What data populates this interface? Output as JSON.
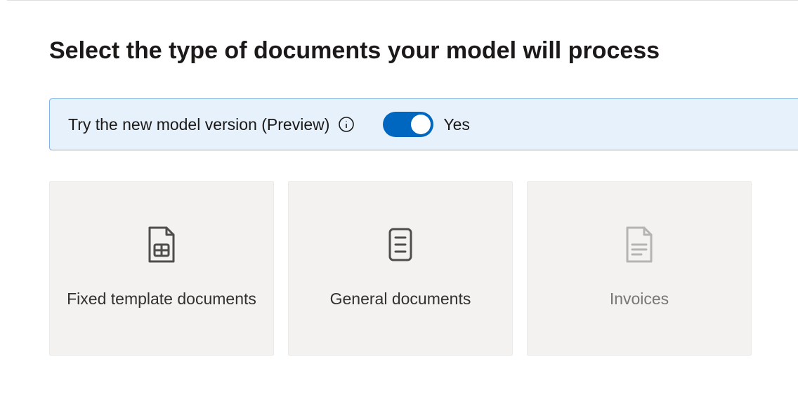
{
  "page": {
    "title": "Select the type of documents your model will process"
  },
  "preview": {
    "label": "Try the new model version (Preview)",
    "toggle_state": "Yes",
    "toggle_on": true
  },
  "cards": [
    {
      "id": "fixed-template",
      "label": "Fixed template documents",
      "enabled": true
    },
    {
      "id": "general-documents",
      "label": "General documents",
      "enabled": true
    },
    {
      "id": "invoices",
      "label": "Invoices",
      "enabled": false
    }
  ]
}
